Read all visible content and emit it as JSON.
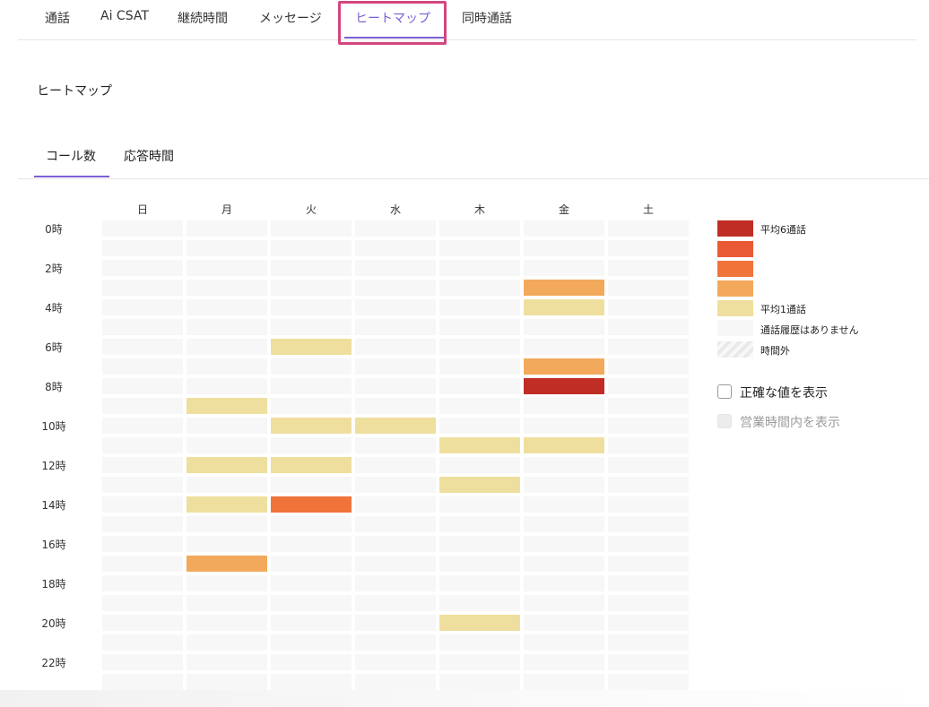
{
  "top_tabs": [
    {
      "label": "通話",
      "active": false
    },
    {
      "label": "Ai CSAT",
      "active": false
    },
    {
      "label": "継続時間",
      "active": false
    },
    {
      "label": "メッセージ",
      "active": false
    },
    {
      "label": "ヒートマップ",
      "active": true
    },
    {
      "label": "同時通話",
      "active": false
    }
  ],
  "page_title": "ヒートマップ",
  "sub_tabs": [
    {
      "label": "コール数",
      "active": true
    },
    {
      "label": "応答時間",
      "active": false
    }
  ],
  "colors": {
    "accent": "#7b5fd6",
    "highlight_box": "#d4467f",
    "empty": "#f7f7f7",
    "levels": [
      "#f7f7f7",
      "#efdf9e",
      "#f2a95b",
      "#f07339",
      "#ea5a34",
      "#c02d25"
    ]
  },
  "heatmap": {
    "days": [
      "日",
      "月",
      "火",
      "水",
      "木",
      "金",
      "土"
    ],
    "hour_labels": [
      "0時",
      "2時",
      "4時",
      "6時",
      "8時",
      "10時",
      "12時",
      "14時",
      "16時",
      "18時",
      "20時",
      "22時"
    ],
    "levels": [
      [
        0,
        0,
        0,
        0,
        0,
        0,
        0
      ],
      [
        0,
        0,
        0,
        0,
        0,
        0,
        0
      ],
      [
        0,
        0,
        0,
        0,
        0,
        0,
        0
      ],
      [
        0,
        0,
        0,
        0,
        0,
        2,
        0
      ],
      [
        0,
        0,
        0,
        0,
        0,
        1,
        0
      ],
      [
        0,
        0,
        0,
        0,
        0,
        0,
        0
      ],
      [
        0,
        0,
        1,
        0,
        0,
        0,
        0
      ],
      [
        0,
        0,
        0,
        0,
        0,
        2,
        0
      ],
      [
        0,
        0,
        0,
        0,
        0,
        5,
        0
      ],
      [
        0,
        1,
        0,
        0,
        0,
        0,
        0
      ],
      [
        0,
        0,
        1,
        1,
        0,
        0,
        0
      ],
      [
        0,
        0,
        0,
        0,
        1,
        1,
        0
      ],
      [
        0,
        1,
        1,
        0,
        0,
        0,
        0
      ],
      [
        0,
        0,
        0,
        0,
        1,
        0,
        0
      ],
      [
        0,
        1,
        3,
        0,
        0,
        0,
        0
      ],
      [
        0,
        0,
        0,
        0,
        0,
        0,
        0
      ],
      [
        0,
        0,
        0,
        0,
        0,
        0,
        0
      ],
      [
        0,
        2,
        0,
        0,
        0,
        0,
        0
      ],
      [
        0,
        0,
        0,
        0,
        0,
        0,
        0
      ],
      [
        0,
        0,
        0,
        0,
        0,
        0,
        0
      ],
      [
        0,
        0,
        0,
        0,
        1,
        0,
        0
      ],
      [
        0,
        0,
        0,
        0,
        0,
        0,
        0
      ],
      [
        0,
        0,
        0,
        0,
        0,
        0,
        0
      ],
      [
        0,
        0,
        0,
        0,
        0,
        0,
        0
      ]
    ]
  },
  "legend": {
    "swatches": [
      {
        "color": "#c02d25",
        "label": "平均6通話"
      },
      {
        "color": "#ea5a34",
        "label": ""
      },
      {
        "color": "#f07339",
        "label": ""
      },
      {
        "color": "#f2a95b",
        "label": ""
      },
      {
        "color": "#efdf9e",
        "label": "平均1通話"
      },
      {
        "color": "#f7f7f7",
        "label": "通話履歴はありません"
      }
    ],
    "out_of_hours": "時間外"
  },
  "options": {
    "show_exact": {
      "label": "正確な値を表示",
      "checked": false,
      "disabled": false
    },
    "business_hours": {
      "label": "営業時間内を表示",
      "checked": false,
      "disabled": true
    }
  }
}
